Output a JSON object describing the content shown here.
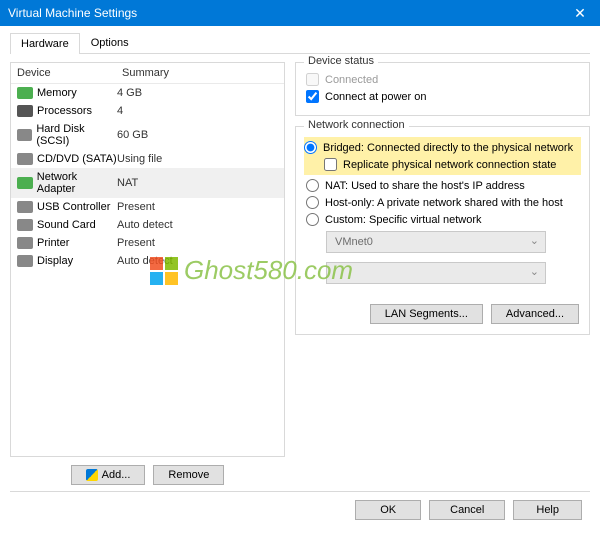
{
  "window": {
    "title": "Virtual Machine Settings",
    "close": "✕"
  },
  "tabs": {
    "hardware": "Hardware",
    "options": "Options"
  },
  "list": {
    "header_device": "Device",
    "header_summary": "Summary",
    "rows": [
      {
        "name": "Memory",
        "summary": "4 GB"
      },
      {
        "name": "Processors",
        "summary": "4"
      },
      {
        "name": "Hard Disk (SCSI)",
        "summary": "60 GB"
      },
      {
        "name": "CD/DVD (SATA)",
        "summary": "Using file"
      },
      {
        "name": "Network Adapter",
        "summary": "NAT"
      },
      {
        "name": "USB Controller",
        "summary": "Present"
      },
      {
        "name": "Sound Card",
        "summary": "Auto detect"
      },
      {
        "name": "Printer",
        "summary": "Present"
      },
      {
        "name": "Display",
        "summary": "Auto detect"
      }
    ]
  },
  "left_buttons": {
    "add": "Add...",
    "remove": "Remove"
  },
  "device_status": {
    "legend": "Device status",
    "connected": "Connected",
    "connect_power_on": "Connect at power on"
  },
  "network": {
    "legend": "Network connection",
    "bridged": "Bridged: Connected directly to the physical network",
    "replicate": "Replicate physical network connection state",
    "nat": "NAT: Used to share the host's IP address",
    "hostonly": "Host-only: A private network shared with the host",
    "custom": "Custom: Specific virtual network",
    "custom_value": "VMnet0",
    "lan_segments": "LAN Segments...",
    "advanced": "Advanced..."
  },
  "footer": {
    "ok": "OK",
    "cancel": "Cancel",
    "help": "Help"
  },
  "watermark": "Ghost580.com",
  "icon_colors": [
    "#4caf50",
    "#555",
    "#888",
    "#888",
    "#4caf50",
    "#888",
    "#888",
    "#888",
    "#888"
  ]
}
